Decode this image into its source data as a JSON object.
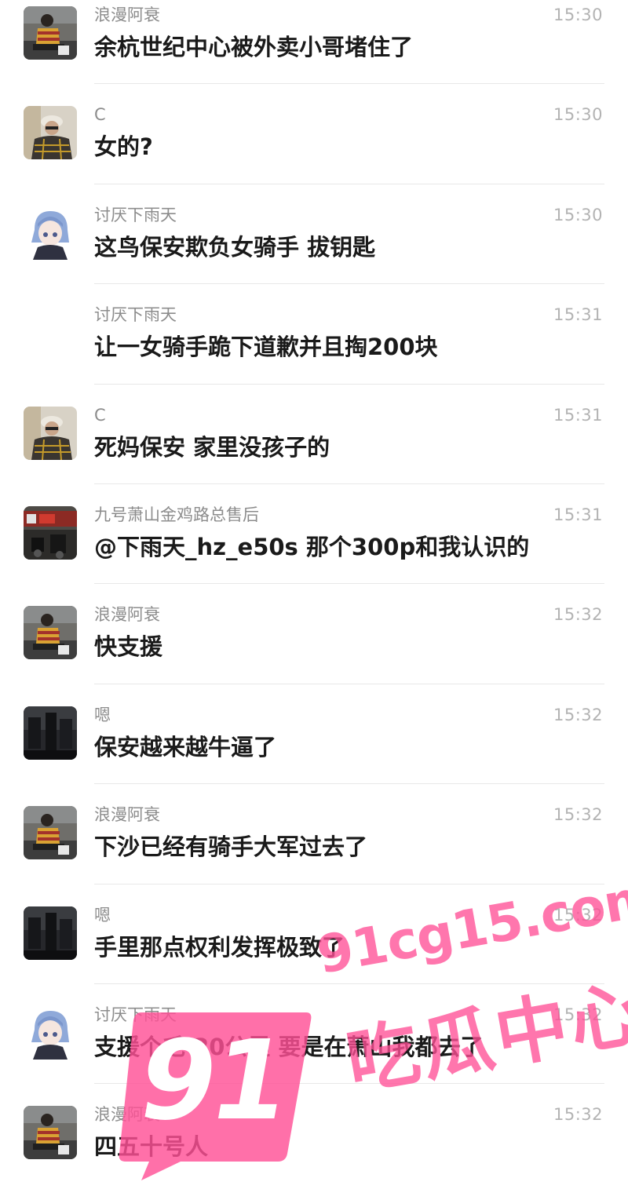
{
  "messages": [
    {
      "name": "浪漫阿衰",
      "time": "15:30",
      "text": "余杭世纪中心被外卖小哥堵住了",
      "avatar": "rider"
    },
    {
      "name": "C",
      "time": "15:30",
      "text": "女的?",
      "avatar": "cap"
    },
    {
      "name": "讨厌下雨天",
      "time": "15:30",
      "text": "这鸟保安欺负女骑手 拔钥匙",
      "avatar": "anime"
    },
    {
      "name": "讨厌下雨天",
      "time": "15:31",
      "text": "让一女骑手跪下道歉并且掏200块",
      "avatar": "none"
    },
    {
      "name": "C",
      "time": "15:31",
      "text": "死妈保安 家里没孩子的",
      "avatar": "cap"
    },
    {
      "name": "九号萧山金鸡路总售后",
      "time": "15:31",
      "text": "@下雨天_hz_e50s 那个300p和我认识的",
      "avatar": "store"
    },
    {
      "name": "浪漫阿衰",
      "time": "15:32",
      "text": "快支援",
      "avatar": "rider"
    },
    {
      "name": "嗯",
      "time": "15:32",
      "text": "保安越来越牛逼了",
      "avatar": "dark"
    },
    {
      "name": "浪漫阿衰",
      "time": "15:32",
      "text": "下沙已经有骑手大军过去了",
      "avatar": "rider"
    },
    {
      "name": "嗯",
      "time": "15:32",
      "text": "手里那点权利发挥极致了",
      "avatar": "dark"
    },
    {
      "name": "讨厌下雨天",
      "time": "15:32",
      "text": "支援个毛 20公里 要是在萧山我都去了",
      "avatar": "anime"
    },
    {
      "name": "浪漫阿衰",
      "time": "15:32",
      "text": "四五十号人",
      "avatar": "rider"
    }
  ],
  "watermark": {
    "site": "91cg15.com",
    "label": "吃瓜中心",
    "logo": "91",
    "color": "#ff5096"
  }
}
